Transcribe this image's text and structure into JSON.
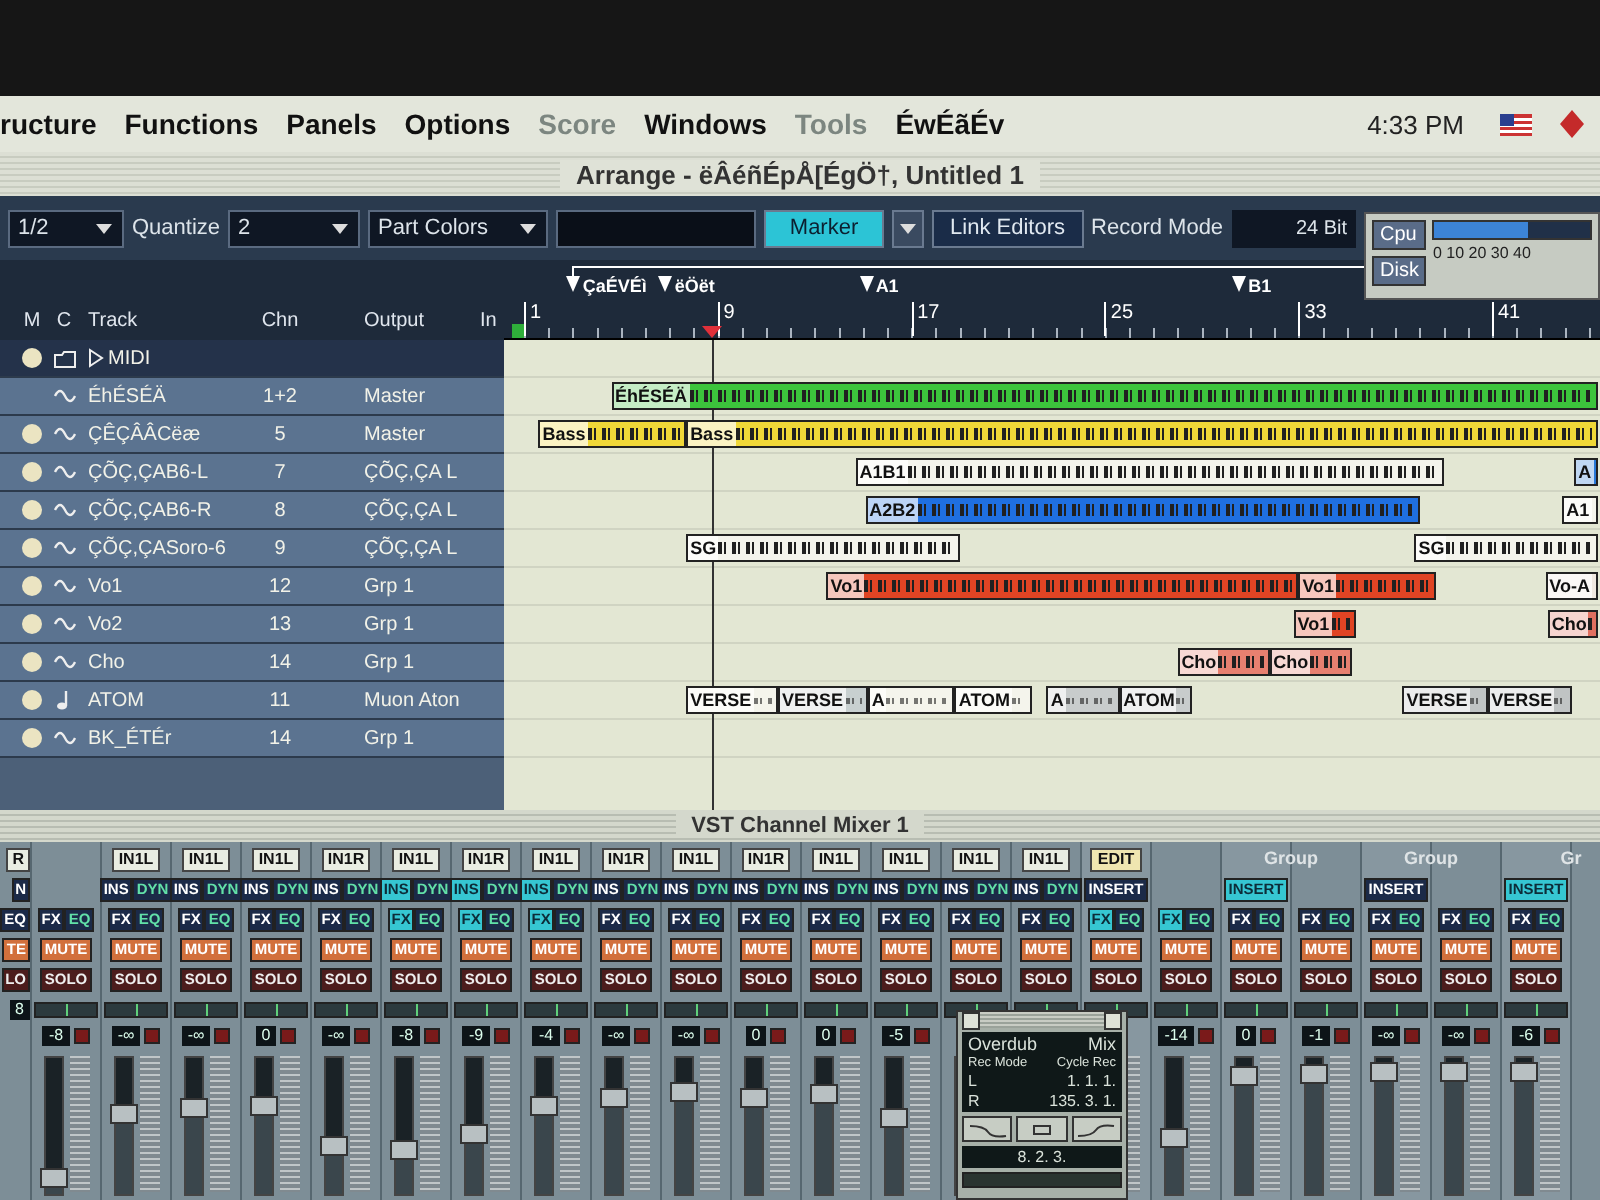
{
  "menubar": {
    "items": [
      {
        "label": "ructure",
        "disabled": false
      },
      {
        "label": "Functions",
        "disabled": false
      },
      {
        "label": "Panels",
        "disabled": false
      },
      {
        "label": "Options",
        "disabled": false
      },
      {
        "label": "Score",
        "disabled": true
      },
      {
        "label": "Windows",
        "disabled": false
      },
      {
        "label": "Tools",
        "disabled": true
      },
      {
        "label": "ÉwÉãÉv",
        "disabled": false
      }
    ],
    "clock": "4:33 PM"
  },
  "window": {
    "title": "Arrange - ëÂéñÉpÅ[ÉgÖ†, Untitled 1"
  },
  "toolbar": [
    {
      "kind": "dropdown",
      "value": "1/2"
    },
    {
      "kind": "label",
      "text": "Quantize"
    },
    {
      "kind": "dropdown",
      "value": "2"
    },
    {
      "kind": "dropdown",
      "value": "Part Colors"
    },
    {
      "kind": "empty_field"
    },
    {
      "kind": "button",
      "text": "Marker",
      "on": true
    },
    {
      "kind": "menu_button"
    },
    {
      "kind": "button",
      "text": "Link Editors",
      "on": false
    },
    {
      "kind": "label",
      "text": "Record Mode"
    },
    {
      "kind": "display",
      "value": "24 Bit"
    }
  ],
  "performance": {
    "cpu_label": "Cpu",
    "disk_label": "Disk",
    "scale": "0 10 20 30 40",
    "cpu": {
      "level": 0.6
    }
  },
  "track_columns": [
    "M",
    "C",
    "Track",
    "Chn",
    "Output",
    "In"
  ],
  "tracks": [
    {
      "name": "MIDI",
      "kind": "folder",
      "dot": true,
      "selected": true
    },
    {
      "name": "ÉhÉSÉÄ",
      "chn": "1+2",
      "output": "Master",
      "kind": "audio",
      "dot": false,
      "selected": false,
      "parts": [
        {
          "label": "ÉhÉSÉÄ",
          "color": "#3cc43c"
        }
      ]
    },
    {
      "name": "ÇÊÇÂÂCëæ",
      "chn": "5",
      "output": "Master",
      "kind": "audio",
      "dot": true,
      "selected": false,
      "parts": [
        {
          "label": "Bass",
          "color": "#f0d838"
        },
        {
          "label": "Bass",
          "color": "#f0d838"
        }
      ]
    },
    {
      "name": "ÇÕÇ,ÇAB6-L",
      "chn": "7",
      "output": "ÇÕÇ,ÇA L",
      "kind": "audio",
      "dot": true,
      "selected": false,
      "parts": [
        {
          "label": "A1B1",
          "color": "#f4f4ec"
        },
        {
          "label": "A",
          "color": "#2878d8"
        }
      ]
    },
    {
      "name": "ÇÕÇ,ÇAB6-R",
      "chn": "8",
      "output": "ÇÕÇ,ÇA L",
      "kind": "audio",
      "dot": true,
      "selected": false,
      "parts": [
        {
          "label": "A2B2",
          "color": "#1f6fe0"
        },
        {
          "label": "A1",
          "color": "#f4f4ec"
        }
      ]
    },
    {
      "name": "ÇÕÇ,ÇASoro-6",
      "chn": "9",
      "output": "ÇÕÇ,ÇA L",
      "kind": "audio",
      "dot": true,
      "selected": false,
      "parts": [
        {
          "label": "SG",
          "color": "#f4f4ec"
        },
        {
          "label": "SG",
          "color": "#f4f4ec"
        }
      ]
    },
    {
      "name": "Vo1",
      "chn": "12",
      "output": "Grp 1",
      "kind": "audio",
      "dot": true,
      "selected": false,
      "parts": [
        {
          "label": "Vo1",
          "color": "#e04424"
        },
        {
          "label": "Vo1",
          "color": "#e04424"
        },
        {
          "label": "Vo-A",
          "color": "#f0e8e0"
        }
      ]
    },
    {
      "name": "Vo2",
      "chn": "13",
      "output": "Grp 1",
      "kind": "audio",
      "dot": true,
      "selected": false,
      "parts": [
        {
          "label": "Vo1",
          "color": "#e04424"
        },
        {
          "label": "Cho",
          "color": "#e07060"
        }
      ]
    },
    {
      "name": "Cho",
      "chn": "14",
      "output": "Grp 1",
      "kind": "audio",
      "dot": true,
      "selected": false,
      "parts": [
        {
          "label": "Cho",
          "color": "#e88070"
        },
        {
          "label": "Cho",
          "color": "#e88070"
        }
      ]
    },
    {
      "name": "ATOM",
      "chn": "11",
      "output": "Muon Aton",
      "kind": "midi",
      "dot": true,
      "selected": false,
      "parts": [
        {
          "label": "VERSE",
          "color": "#f4f4ec"
        },
        {
          "label": "VERSE",
          "color": "#c8d0d0"
        },
        {
          "label": "A",
          "color": "#f4f4ec"
        },
        {
          "label": "ATOM",
          "color": "#f4f4ec"
        },
        {
          "label": "A",
          "color": "#c8cccc"
        },
        {
          "label": "ATOM",
          "color": "#c8cccc"
        },
        {
          "label": "VERSE",
          "color": "#c0c4c4"
        },
        {
          "label": "VERSE",
          "color": "#c0c4c4"
        }
      ]
    },
    {
      "name": "BK_ÉTÉr",
      "chn": "14",
      "output": "Grp 1",
      "kind": "audio",
      "dot": true,
      "selected": false
    }
  ],
  "arrange": {
    "markers": [
      {
        "label": "ÇaÉVÉì"
      },
      {
        "label": "ëÖët"
      },
      {
        "label": "A1"
      },
      {
        "label": "B1"
      }
    ],
    "ruler": [
      "1",
      "9",
      "17",
      "25",
      "33",
      "41"
    ]
  },
  "mixer": {
    "title": "VST Channel Mixer 1",
    "channels": [
      {
        "kind": "cut",
        "input": "R",
        "insert": [
          "N"
        ],
        "fx": [
          "EQ"
        ],
        "mute": "TE",
        "solo": "LO",
        "value": "8",
        "insert_on": false,
        "fx_on": false
      },
      {
        "kind": "stereo_right",
        "fx": [
          "FX",
          "EQ"
        ],
        "mute": "MUTE",
        "solo": "SOLO",
        "value": "-8",
        "fx_on": false,
        "level": 0.05
      },
      {
        "kind": "input",
        "input": "IN1L",
        "insert": [
          "INS",
          "DYN"
        ],
        "fx": [
          "FX",
          "EQ"
        ],
        "mute": "MUTE",
        "solo": "SOLO",
        "value": "-∞",
        "insert_on": false,
        "fx_on": false,
        "level": 0.6
      },
      {
        "kind": "input",
        "input": "IN1L",
        "insert": [
          "INS",
          "DYN"
        ],
        "fx": [
          "FX",
          "EQ"
        ],
        "mute": "MUTE",
        "solo": "SOLO",
        "value": "-∞",
        "insert_on": false,
        "fx_on": false,
        "level": 0.65
      },
      {
        "kind": "input",
        "input": "IN1L",
        "insert": [
          "INS",
          "DYN"
        ],
        "fx": [
          "FX",
          "EQ"
        ],
        "mute": "MUTE",
        "solo": "SOLO",
        "value": "0",
        "insert_on": false,
        "fx_on": false,
        "level": 0.67
      },
      {
        "kind": "input",
        "input": "IN1R",
        "insert": [
          "INS",
          "DYN"
        ],
        "fx": [
          "FX",
          "EQ"
        ],
        "mute": "MUTE",
        "solo": "SOLO",
        "value": "-∞",
        "insert_on": false,
        "fx_on": false,
        "level": 0.33
      },
      {
        "kind": "input",
        "input": "IN1L",
        "insert": [
          "INS",
          "DYN"
        ],
        "fx": [
          "FX",
          "EQ"
        ],
        "mute": "MUTE",
        "solo": "SOLO",
        "value": "-8",
        "insert_on": true,
        "fx_on": true,
        "level": 0.3
      },
      {
        "kind": "input",
        "input": "IN1R",
        "insert": [
          "INS",
          "DYN"
        ],
        "fx": [
          "FX",
          "EQ"
        ],
        "mute": "MUTE",
        "solo": "SOLO",
        "value": "-9",
        "insert_on": true,
        "fx_on": true,
        "level": 0.43
      },
      {
        "kind": "input",
        "input": "IN1L",
        "insert": [
          "INS",
          "DYN"
        ],
        "fx": [
          "FX",
          "EQ"
        ],
        "mute": "MUTE",
        "solo": "SOLO",
        "value": "-4",
        "insert_on": true,
        "fx_on": true,
        "level": 0.67
      },
      {
        "kind": "input",
        "input": "IN1R",
        "insert": [
          "INS",
          "DYN"
        ],
        "fx": [
          "FX",
          "EQ"
        ],
        "mute": "MUTE",
        "solo": "SOLO",
        "value": "-∞",
        "insert_on": false,
        "fx_on": false,
        "level": 0.75
      },
      {
        "kind": "input",
        "input": "IN1L",
        "insert": [
          "INS",
          "DYN"
        ],
        "fx": [
          "FX",
          "EQ"
        ],
        "mute": "MUTE",
        "solo": "SOLO",
        "value": "-∞",
        "insert_on": false,
        "fx_on": false,
        "level": 0.8
      },
      {
        "kind": "input",
        "input": "IN1R",
        "insert": [
          "INS",
          "DYN"
        ],
        "fx": [
          "FX",
          "EQ"
        ],
        "mute": "MUTE",
        "solo": "SOLO",
        "value": "0",
        "insert_on": false,
        "fx_on": false,
        "level": 0.75
      },
      {
        "kind": "input",
        "input": "IN1L",
        "insert": [
          "INS",
          "DYN"
        ],
        "fx": [
          "FX",
          "EQ"
        ],
        "mute": "MUTE",
        "solo": "SOLO",
        "value": "0",
        "insert_on": false,
        "fx_on": false,
        "level": 0.77
      },
      {
        "kind": "input",
        "input": "IN1L",
        "insert": [
          "INS",
          "DYN"
        ],
        "fx": [
          "FX",
          "EQ"
        ],
        "mute": "MUTE",
        "solo": "SOLO",
        "value": "-5",
        "insert_on": false,
        "fx_on": false,
        "level": 0.57
      },
      {
        "kind": "input",
        "input": "IN1L",
        "insert": [
          "INS",
          "DYN"
        ],
        "fx": [
          "FX",
          "EQ"
        ],
        "mute": "MUTE",
        "solo": "SOLO",
        "insert_on": false,
        "fx_on": false
      },
      {
        "kind": "input",
        "input": "IN1L",
        "insert": [
          "INS",
          "DYN"
        ],
        "fx": [
          "FX",
          "EQ"
        ],
        "mute": "MUTE",
        "solo": "SOLO",
        "insert_on": false,
        "fx_on": false
      },
      {
        "kind": "edit",
        "input": "EDIT",
        "insert": [
          "INSERT"
        ],
        "fx": [
          "FX",
          "EQ"
        ],
        "mute": "MUTE",
        "solo": "SOLO",
        "insert_on": false,
        "fx_on": true
      },
      {
        "kind": "stereo_right",
        "fx": [
          "FX",
          "EQ"
        ],
        "mute": "MUTE",
        "solo": "SOLO",
        "value": "-14",
        "fx_on": true,
        "level": 0.4
      },
      {
        "kind": "group",
        "header": "Group",
        "insert": [
          "INSERT"
        ],
        "fx": [
          "FX",
          "EQ"
        ],
        "mute": "MUTE",
        "solo": "SOLO",
        "value": "0",
        "insert_on": true,
        "fx_on": false,
        "level": 0.93
      },
      {
        "kind": "stereo_right",
        "fx": [
          "FX",
          "EQ"
        ],
        "mute": "MUTE",
        "solo": "SOLO",
        "value": "-1",
        "fx_on": false,
        "level": 0.95
      },
      {
        "kind": "group",
        "header": "Group",
        "insert": [
          "INSERT"
        ],
        "fx": [
          "FX",
          "EQ"
        ],
        "mute": "MUTE",
        "solo": "SOLO",
        "value": "-∞",
        "insert_on": false,
        "fx_on": false,
        "level": 0.97
      },
      {
        "kind": "stereo_right",
        "fx": [
          "FX",
          "EQ"
        ],
        "mute": "MUTE",
        "solo": "SOLO",
        "value": "-∞",
        "fx_on": false,
        "level": 0.97
      },
      {
        "kind": "group",
        "header": "Gr",
        "insert": [
          "INSERT"
        ],
        "fx": [
          "FX",
          "EQ"
        ],
        "mute": "MUTE",
        "solo": "SOLO",
        "value": "-6",
        "insert_on": true,
        "fx_on": false,
        "level": 0.97
      }
    ]
  },
  "transport": {
    "rec_mode": "Overdub",
    "mix": "Mix",
    "rec_mode_label": "Rec Mode",
    "cycle_label": "Cycle Rec",
    "left_label": "L",
    "left": "1. 1. 1.",
    "right_label": "R",
    "right": "135. 3. 1.",
    "position": "8. 2. 3."
  }
}
